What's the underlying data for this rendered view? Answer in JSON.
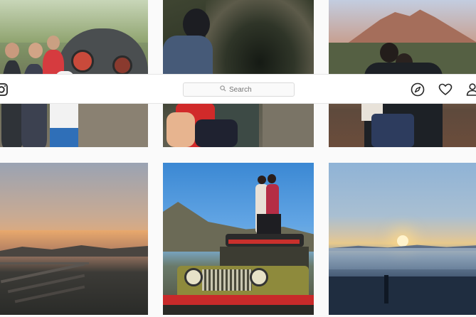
{
  "search": {
    "placeholder": "Search"
  },
  "nav": {
    "logo_icon": "instagram-glyph-icon",
    "explore_icon": "compass-icon",
    "activity_icon": "heart-icon",
    "profile_icon": "person-icon"
  },
  "colors": {
    "background": "#fafafa",
    "navbar": "#ffffff",
    "border": "#dbdbdb",
    "icon": "#262626"
  },
  "grid": {
    "posts": [
      {
        "subject": "family-group-photo"
      },
      {
        "subject": "cave-rope-descent"
      },
      {
        "subject": "couple-volcano-view"
      },
      {
        "subject": "sunset-over-hills"
      },
      {
        "subject": "couple-on-jeep"
      },
      {
        "subject": "sunrise-above-clouds"
      }
    ]
  }
}
